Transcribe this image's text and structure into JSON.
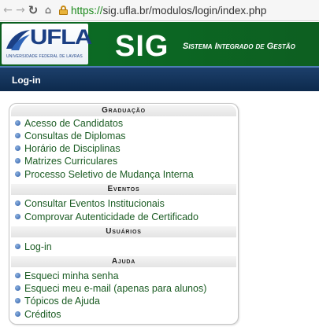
{
  "browser": {
    "back_icon": "arrow-left-icon",
    "forward_icon": "arrow-right-icon",
    "reload_icon": "reload-icon",
    "home_icon": "home-icon",
    "lock_icon": "https-lock-icon",
    "url_scheme": "https://",
    "url_rest": "sig.ufla.br/modulos/login/index.php"
  },
  "header": {
    "logo_text": "UFLA",
    "logo_sub": "UNIVERSIDADE FEDERAL DE LAVRAS",
    "app_name": "SIG",
    "app_subtitle": "Sistema Integrado de Gestão",
    "colors": {
      "banner": "#0c6a24",
      "logo_blue": "#1b3f84"
    }
  },
  "login_bar": {
    "title": "Log-in",
    "color": "#0d2a4d"
  },
  "menu": {
    "link_color": "#1b5c23",
    "sections": [
      {
        "title": "Graduação",
        "items": [
          "Acesso de Candidatos",
          "Consultas de Diplomas",
          "Horário de Disciplinas",
          "Matrizes Curriculares",
          "Processo Seletivo de Mudança Interna"
        ]
      },
      {
        "title": "Eventos",
        "items": [
          "Consultar Eventos Institucionais",
          "Comprovar Autenticidade de Certificado"
        ]
      },
      {
        "title": "Usuários",
        "items": [
          "Log-in"
        ]
      },
      {
        "title": "Ajuda",
        "items": [
          "Esqueci minha senha",
          "Esqueci meu e-mail (apenas para alunos)",
          "Tópicos de Ajuda",
          "Créditos"
        ]
      }
    ]
  }
}
